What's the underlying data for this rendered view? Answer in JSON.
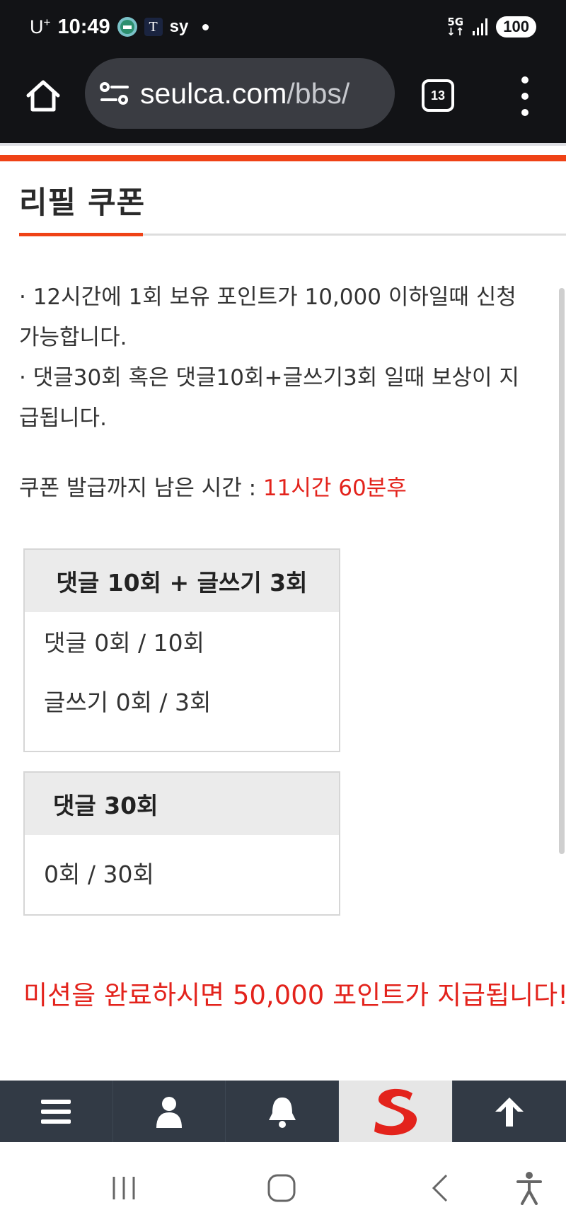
{
  "status_bar": {
    "carrier": "U",
    "carrier_sup": "+",
    "time": "10:49",
    "app_letter": "T",
    "app_text": "sy",
    "network": "5G",
    "battery": "100"
  },
  "browser": {
    "url_host": "seulca.com",
    "url_path": "/bbs/",
    "tab_count": "13"
  },
  "page": {
    "title": "리필 쿠폰",
    "notice_lines": [
      "· 12시간에 1회 보유 포인트가 10,000 이하일때 신청",
      "가능합니다.",
      "· 댓글30회 혹은 댓글10회+글쓰기3회 일때 보상이 지",
      "급됩니다."
    ],
    "remaining_label": "쿠폰 발급까지 남은 시간 : ",
    "remaining_value": "11시간 60분후",
    "missions": [
      {
        "header": "댓글 10회 + 글쓰기 3회",
        "rows": [
          "댓글 0회 / 10회",
          "글쓰기 0회 / 3회"
        ]
      },
      {
        "header": "댓글 30회",
        "rows": [
          "0회 / 30회"
        ]
      }
    ],
    "reward_text": "미션을 완료하시면 50,000 포인트가 지급됩니다!"
  },
  "bottom_nav": {
    "items": [
      "menu-icon",
      "user-icon",
      "bell-icon",
      "site-logo",
      "arrow-up-icon"
    ]
  },
  "colors": {
    "accent": "#ef4216",
    "highlight_red": "#e3231c",
    "dark_bar": "#121316",
    "nav_bg": "#323a45"
  }
}
